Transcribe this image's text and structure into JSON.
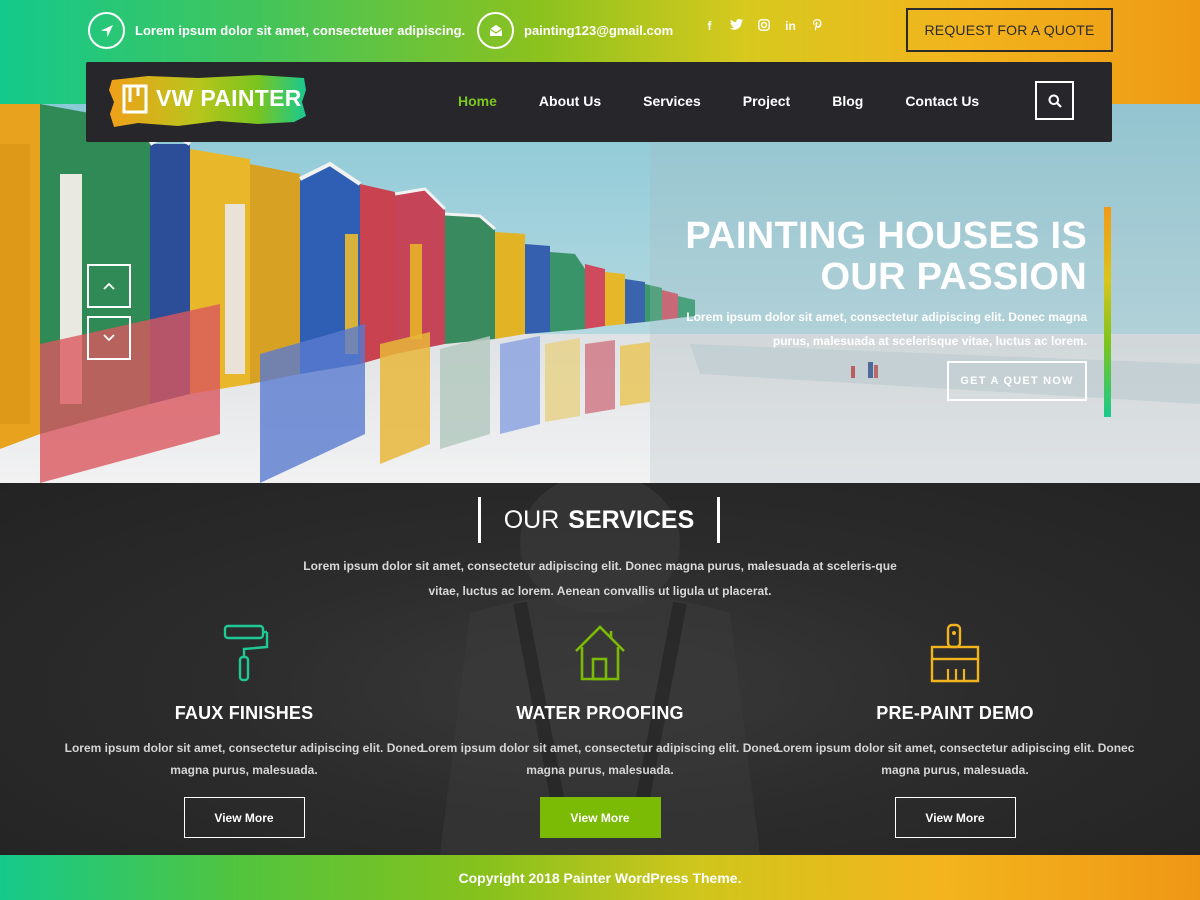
{
  "topbar": {
    "address": "Lorem ipsum dolor sit amet, consectetuer adipiscing.",
    "email": "painting123@gmail.com",
    "social": [
      {
        "icon": "facebook-icon",
        "glyph": "f"
      },
      {
        "icon": "twitter-icon",
        "glyph": "🐦"
      },
      {
        "icon": "instagram-icon",
        "glyph": "◎"
      },
      {
        "icon": "linkedin-icon",
        "glyph": "in"
      },
      {
        "icon": "pinterest-icon",
        "glyph": "℗"
      }
    ],
    "quote_button": "REQUEST FOR A QUOTE"
  },
  "nav": {
    "logo": "VW PAINTER",
    "items": [
      "Home",
      "About Us",
      "Services",
      "Project",
      "Blog",
      "Contact Us"
    ],
    "active": "Home"
  },
  "hero": {
    "title_line1": "PAINTING HOUSES IS",
    "title_line2": "OUR PASSION",
    "text": "Lorem ipsum dolor sit amet, consectetur adipiscing elit. Donec magna purus, malesuada at scelerisque vitae, luctus ac lorem.",
    "button": "GET A QUET NOW"
  },
  "services": {
    "title_thin": "OUR",
    "title_bold": "SERVICES",
    "intro": "Lorem ipsum dolor sit amet, consectetur adipiscing elit. Donec magna purus, malesuada at sceleris-que vitae, luctus ac lorem. Aenean convallis ut ligula ut placerat.",
    "cards": [
      {
        "title": "FAUX FINISHES",
        "text": "Lorem ipsum dolor sit amet, consectetur adipiscing elit. Donec magna purus, malesuada.",
        "button": "View More",
        "icon": "paint-roller-icon"
      },
      {
        "title": "WATER PROOFING",
        "text": "Lorem ipsum dolor sit amet, consectetur adipiscing elit. Donec magna purus, malesuada.",
        "button": "View More",
        "icon": "house-icon"
      },
      {
        "title": "PRE-PAINT DEMO",
        "text": "Lorem ipsum dolor sit amet, consectetur adipiscing elit. Donec magna purus, malesuada.",
        "button": "View More",
        "icon": "paint-brush-icon"
      }
    ]
  },
  "footer": {
    "copyright": "Copyright 2018 Painter WordPress Theme."
  },
  "colors": {
    "accent_green": "#7bba05",
    "nav_bg": "#27262b",
    "teal_icon": "#1fc995",
    "yellow_icon": "#f2b41d"
  }
}
